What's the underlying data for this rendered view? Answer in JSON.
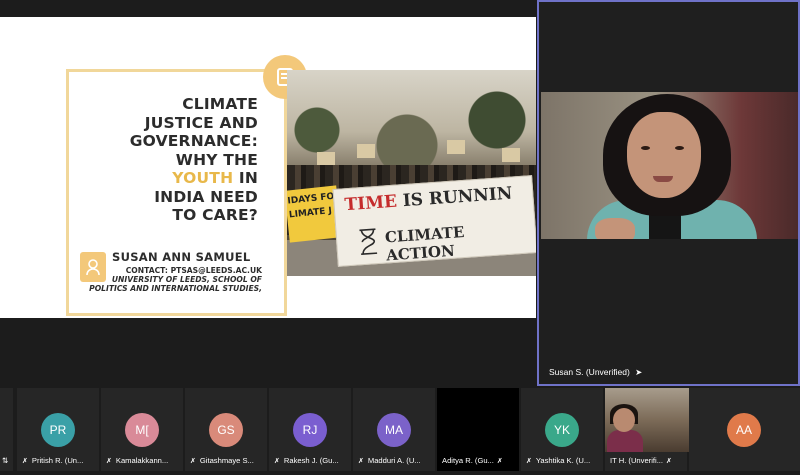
{
  "slide": {
    "title_lines": [
      "CLIMATE",
      "JUSTICE AND",
      "GOVERNANCE:",
      "WHY THE",
      "IN",
      "INDIA NEED",
      "TO CARE?"
    ],
    "title_highlight": "YOUTH",
    "author": "SUSAN ANN SAMUEL",
    "contact": "CONTACT: PTSAS@LEEDS.AC.UK",
    "affiliation_line1": "UNIVERSITY OF LEEDS, SCHOOL OF",
    "affiliation_line2": "POLITICS AND INTERNATIONAL STUDIES,",
    "banner_text_1a": "TIME",
    "banner_text_1b": " IS RUNNIN",
    "banner_text_2": "CLIMATE ACTION",
    "banner_small": "IDAYS FO",
    "banner_small_2": "LIMATE J"
  },
  "speaker": {
    "label": "Susan S. (Unverified)"
  },
  "participants": [
    {
      "initials": "",
      "name": "",
      "color": "#262626"
    },
    {
      "initials": "PR",
      "name": "Pritish R. (Un...",
      "color": "#3aa0a7"
    },
    {
      "initials": "M[",
      "name": "Kamalakkann...",
      "color": "#d98a98"
    },
    {
      "initials": "GS",
      "name": "Gitashmaye S...",
      "color": "#d98a7a"
    },
    {
      "initials": "RJ",
      "name": "Rakesh J. (Gu...",
      "color": "#7a5ed0"
    },
    {
      "initials": "MA",
      "name": "Madduri A. (U...",
      "color": "#7b62c9"
    },
    {
      "initials": "",
      "name": "Aditya R. (Gu...",
      "color": "#000000"
    },
    {
      "initials": "YK",
      "name": "Yashtika K. (U...",
      "color": "#3aa88a"
    },
    {
      "initials": "",
      "name": "IT H. (Unverifi...",
      "color": "#262626"
    },
    {
      "initials": "AA",
      "name": "",
      "color": "#e07a4a"
    }
  ],
  "colors": {
    "accent_border": "#6f72c8",
    "frame_gold": "#f1d79a",
    "badge_gold": "#f3c87a"
  },
  "icons": {
    "speaker_pin": "pin-icon",
    "muted_mic": "mic-muted-icon"
  }
}
